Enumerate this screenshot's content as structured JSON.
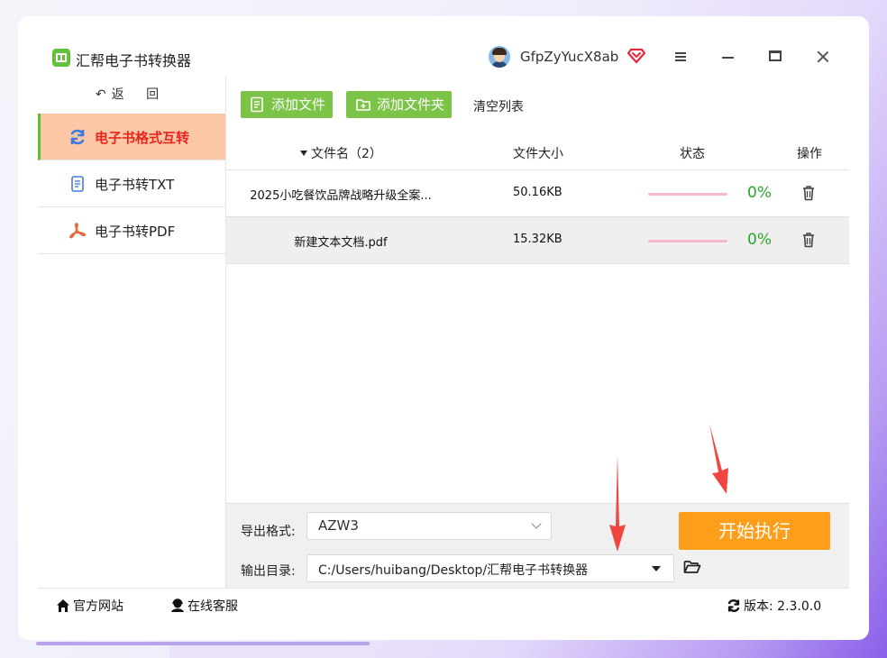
{
  "app": {
    "title": "汇帮电子书转换器",
    "username": "GfpZyYucX8ab"
  },
  "sidebar": {
    "back_label": "返 回",
    "back_arrow": "↶",
    "items": [
      {
        "label": "电子书格式互转",
        "icon": "refresh-icon",
        "active": true
      },
      {
        "label": "电子书转TXT",
        "icon": "document-icon",
        "active": false
      },
      {
        "label": "电子书转PDF",
        "icon": "pdf-icon",
        "active": false
      }
    ]
  },
  "toolbar": {
    "add_file": "添加文件",
    "add_folder": "添加文件夹",
    "clear_list": "清空列表"
  },
  "table": {
    "headers": {
      "name": "文件名（2）",
      "size": "文件大小",
      "status": "状态",
      "op": "操作"
    },
    "rows": [
      {
        "name": "2025小吃餐饮品牌战略升级全案...",
        "size": "50.16KB",
        "progress": 0,
        "percent": "0%"
      },
      {
        "name": "新建文本文档.pdf",
        "size": "15.32KB",
        "progress": 0,
        "percent": "0%"
      }
    ]
  },
  "settings": {
    "format_label": "导出格式:",
    "format_value": "AZW3",
    "dir_label": "输出目录:",
    "dir_value": "C:/Users/huibang/Desktop/汇帮电子书转换器",
    "start_label": "开始执行"
  },
  "footer": {
    "site": "官方网站",
    "service": "在线客服",
    "version": "版本: 2.3.0.0"
  },
  "colors": {
    "accent_green": "#7bc447",
    "active_bg": "#fbc7a7",
    "active_text": "#e8261d",
    "start_orange": "#ff9e1b",
    "progress_track": "#f4b8c8",
    "percent_green": "#2aa52a",
    "arrow_red": "#f0463f"
  }
}
